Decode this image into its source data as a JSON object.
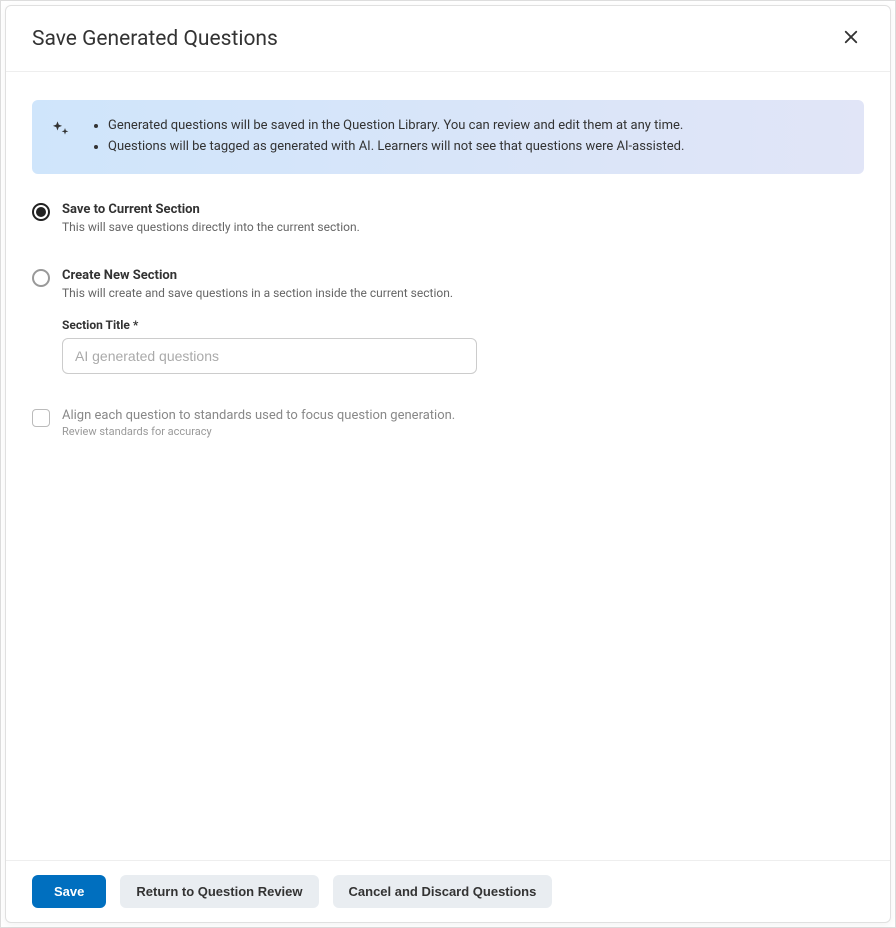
{
  "dialog": {
    "title": "Save Generated Questions"
  },
  "banner": {
    "items": [
      "Generated questions will be saved in the Question Library. You can review and edit them at any time.",
      "Questions will be tagged as generated with AI. Learners will not see that questions were AI-assisted."
    ]
  },
  "options": {
    "current": {
      "label": "Save to Current Section",
      "desc": "This will save questions directly into the current section."
    },
    "new": {
      "label": "Create New Section",
      "desc": "This will create and save questions in a section inside the current section.",
      "field_label": "Section Title *",
      "placeholder": "AI generated questions"
    }
  },
  "align": {
    "label": "Align each question to standards used to focus question generation.",
    "sub": "Review standards for accuracy"
  },
  "footer": {
    "save": "Save",
    "return": "Return to Question Review",
    "cancel": "Cancel and Discard Questions"
  }
}
